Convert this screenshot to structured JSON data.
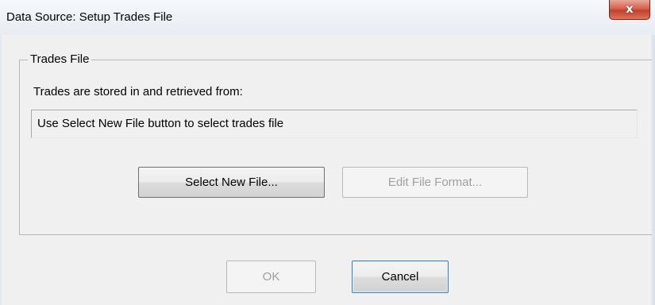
{
  "window": {
    "title": "Data Source: Setup Trades File",
    "close_glyph": "x",
    "close_icon": "close-icon"
  },
  "group": {
    "legend": "Trades File",
    "description": "Trades are stored in and retrieved from:",
    "path_value": "Use Select New File button to select trades file"
  },
  "buttons": {
    "select_new_file": "Select New File...",
    "edit_file_format": "Edit File Format...",
    "ok": "OK",
    "cancel": "Cancel"
  },
  "colors": {
    "dialog_background": "#f0f0f0",
    "close_button": "#c3402a",
    "disabled_text": "#a0a0a0",
    "default_button_border": "#3c7fb1"
  }
}
